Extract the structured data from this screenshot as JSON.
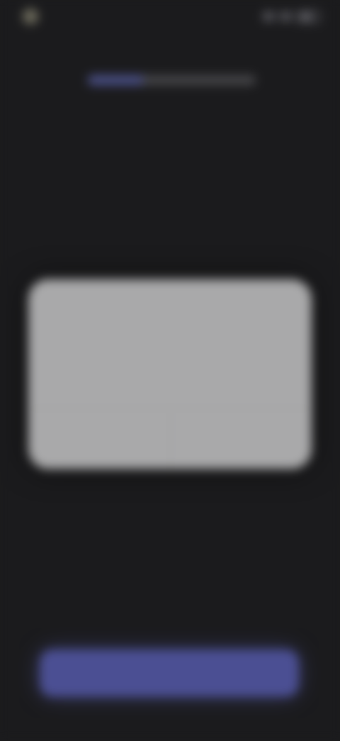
{
  "status_bar": {
    "time": "",
    "icons": [
      "signal-icon",
      "wifi-icon",
      "battery-icon"
    ]
  },
  "onboarding": {
    "progress": 0.33,
    "title": "",
    "subtitle": ""
  },
  "dialog": {
    "title": "",
    "body": "",
    "secondary_label": "",
    "primary_label": ""
  },
  "footer": {
    "continue_label": ""
  },
  "colors": {
    "background": "#1b1b1d",
    "accent": "#4b4f93",
    "dialog": "#a9a9aa"
  }
}
